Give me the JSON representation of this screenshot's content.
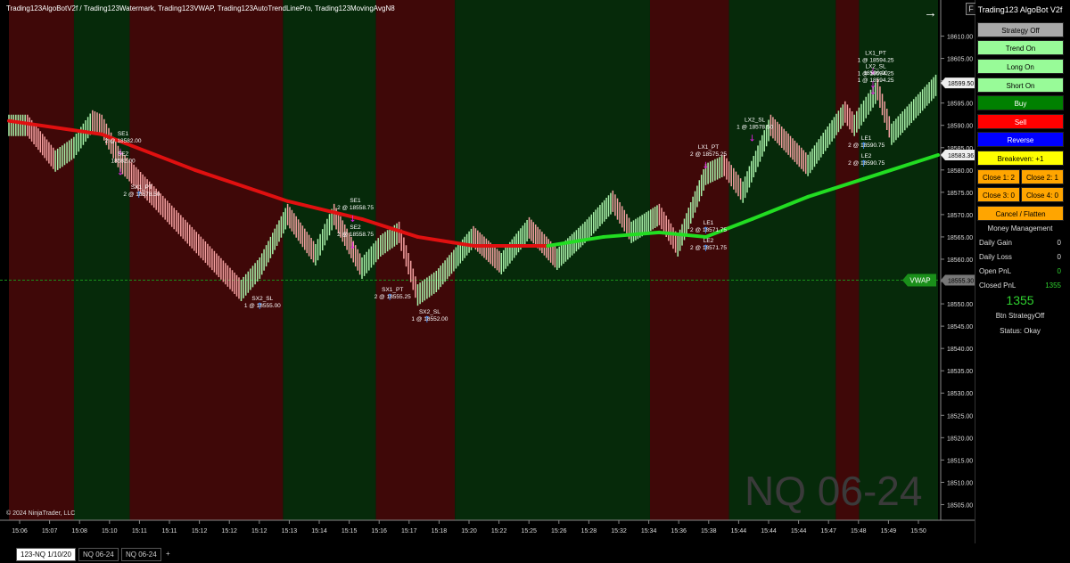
{
  "chart_title": "Trading123AlgoBotV2f / Trading123Watermark, Trading123VWAP, Trading123AutoTrendLinePro, Trading123MovingAvgN8",
  "f_button": "F",
  "copyright": "© 2024 NinjaTrader, LLC",
  "watermark": "NQ 06-24",
  "panel": {
    "title": "Trading123 AlgoBot V2f",
    "strategy_btn": "Strategy Off",
    "trend_btn": "Trend On",
    "long_btn": "Long On",
    "short_btn": "Short On",
    "buy_btn": "Buy",
    "sell_btn": "Sell",
    "reverse_btn": "Reverse",
    "breakeven_btn": "Breakeven: +1",
    "close1_btn": "Close 1: 2",
    "close2_btn": "Close 2: 1",
    "close3_btn": "Close 3: 0",
    "close4_btn": "Close 4: 0",
    "cancel_btn": "Cancel / Flatten",
    "mm_header": "Money Management",
    "daily_gain_label": "Daily Gain",
    "daily_gain": "0",
    "daily_loss_label": "Daily Loss",
    "daily_loss": "0",
    "open_pnl_label": "Open PnL",
    "open_pnl": "0",
    "closed_pnl_label": "Closed PnL",
    "closed_pnl": "1355",
    "big_pnl": "1355",
    "btn_state": "Btn StrategyOff",
    "status": "Status: Okay",
    "colors": {
      "gray": "#a9a9a9",
      "lightgreen": "#98fb98",
      "green": "#008000",
      "red": "#ff0000",
      "blue": "#0000ff",
      "yellow": "#ffff00",
      "orange": "#ffa500"
    }
  },
  "tabs": [
    "123-NQ 1/10/20",
    "NQ 06-24",
    "NQ 06-24",
    "+"
  ],
  "chart_data": {
    "type": "line",
    "ylim": [
      18501.5,
      18614.5
    ],
    "y_ticks": [
      18610.0,
      18605.0,
      18600.0,
      18595.0,
      18590.0,
      18585.0,
      18580.0,
      18575.0,
      18570.0,
      18565.0,
      18560.0,
      18555.0,
      18550.0,
      18545.0,
      18540.0,
      18535.0,
      18530.0,
      18525.0,
      18520.0,
      18515.0,
      18510.0,
      18505.0
    ],
    "x_ticks": [
      "15:06",
      "15:07",
      "15:08",
      "15:10",
      "15:11",
      "15:11",
      "15:12",
      "15:12",
      "15:12",
      "15:13",
      "15:14",
      "15:15",
      "15:16",
      "15:17",
      "15:18",
      "15:20",
      "15:22",
      "15:25",
      "15:26",
      "15:28",
      "15:32",
      "15:34",
      "15:36",
      "15:38",
      "15:44",
      "15:44",
      "15:44",
      "15:47",
      "15:48",
      "15:49",
      "15:50"
    ],
    "price_labels": [
      {
        "text": "18599.50",
        "value": 18599.5,
        "style": "white"
      },
      {
        "text": "18583.36",
        "value": 18583.36,
        "style": "white"
      },
      {
        "text": "18555.30",
        "value": 18555.3,
        "style": "gray"
      }
    ],
    "vwap_label": "VWAP",
    "vwap_value": 18555.3,
    "price_path": [
      [
        0.0,
        18590
      ],
      [
        0.02,
        18590
      ],
      [
        0.05,
        18582
      ],
      [
        0.07,
        18585
      ],
      [
        0.09,
        18591
      ],
      [
        0.1,
        18590
      ],
      [
        0.12,
        18582
      ],
      [
        0.25,
        18553
      ],
      [
        0.27,
        18558
      ],
      [
        0.3,
        18570
      ],
      [
        0.33,
        18561
      ],
      [
        0.35,
        18570
      ],
      [
        0.38,
        18558
      ],
      [
        0.4,
        18563
      ],
      [
        0.42,
        18566
      ],
      [
        0.44,
        18552
      ],
      [
        0.46,
        18555
      ],
      [
        0.5,
        18565
      ],
      [
        0.53,
        18559
      ],
      [
        0.56,
        18567
      ],
      [
        0.59,
        18560
      ],
      [
        0.62,
        18566
      ],
      [
        0.65,
        18573
      ],
      [
        0.67,
        18566
      ],
      [
        0.7,
        18570
      ],
      [
        0.72,
        18563
      ],
      [
        0.75,
        18579
      ],
      [
        0.77,
        18581
      ],
      [
        0.79,
        18575
      ],
      [
        0.82,
        18590
      ],
      [
        0.86,
        18581
      ],
      [
        0.9,
        18593
      ],
      [
        0.91,
        18590
      ],
      [
        0.935,
        18598
      ],
      [
        0.95,
        18588
      ],
      [
        1.0,
        18599.5
      ]
    ],
    "ma_path": [
      [
        0.0,
        18591
      ],
      [
        0.1,
        18588
      ],
      [
        0.2,
        18580
      ],
      [
        0.3,
        18573
      ],
      [
        0.38,
        18569
      ],
      [
        0.44,
        18565
      ],
      [
        0.5,
        18563
      ],
      [
        0.58,
        18563
      ],
      [
        0.64,
        18565
      ],
      [
        0.7,
        18566
      ],
      [
        0.75,
        18565
      ],
      [
        0.8,
        18569
      ],
      [
        0.86,
        18574
      ],
      [
        0.92,
        18578
      ],
      [
        1.0,
        18583.36
      ]
    ],
    "ma_color_switch": 0.55,
    "annotations": [
      {
        "text": [
          "SE1",
          "2 @ 18582.00"
        ],
        "x": 0.12,
        "y": 18585,
        "arrow": "down"
      },
      {
        "text": [
          "SE2",
          "18582.00"
        ],
        "x": 0.12,
        "y": 18580.5,
        "arrow": "down"
      },
      {
        "text": [
          "SX1_PT",
          "2 @ 18578.50"
        ],
        "x": 0.14,
        "y": 18573,
        "arrow": "up"
      },
      {
        "text": [
          "SX2_SL",
          "1 @ 18555.00"
        ],
        "x": 0.27,
        "y": 18548,
        "arrow": "up"
      },
      {
        "text": [
          "SE1",
          "2 @ 18558.75"
        ],
        "x": 0.37,
        "y": 18570,
        "arrow": "down"
      },
      {
        "text": [
          "SE2",
          "2 @ 18558.75"
        ],
        "x": 0.37,
        "y": 18564,
        "arrow": "down"
      },
      {
        "text": [
          "SX1_PT",
          "2 @ 18555.25"
        ],
        "x": 0.41,
        "y": 18550,
        "arrow": "up"
      },
      {
        "text": [
          "SX2_SL",
          "1 @ 18552.00"
        ],
        "x": 0.45,
        "y": 18545,
        "arrow": "up"
      },
      {
        "text": [
          "LX1_PT",
          "2 @ 18575.25"
        ],
        "x": 0.75,
        "y": 18582,
        "arrow": "down"
      },
      {
        "text": [
          "LE1",
          "2 @ 18571.75"
        ],
        "x": 0.75,
        "y": 18565,
        "arrow": "up"
      },
      {
        "text": [
          "LE2",
          "2 @ 18571.75"
        ],
        "x": 0.75,
        "y": 18561,
        "arrow": "up"
      },
      {
        "text": [
          "LX2_SL",
          "1 @ 18578.50"
        ],
        "x": 0.8,
        "y": 18588,
        "arrow": "down"
      },
      {
        "text": [
          "LE1",
          "2 @ 18590.75"
        ],
        "x": 0.92,
        "y": 18584,
        "arrow": "up"
      },
      {
        "text": [
          "LE2",
          "2 @ 18590.75"
        ],
        "x": 0.92,
        "y": 18580,
        "arrow": "up"
      },
      {
        "text": [
          "LX1_PT",
          "1 @ 18594.25"
        ],
        "x": 0.93,
        "y": 18603,
        "arrow": "down"
      },
      {
        "text": [
          "LX2_SL",
          "1 @ 18594.25"
        ],
        "x": 0.93,
        "y": 18600,
        "arrow": "down"
      },
      {
        "text": [
          "18590.00",
          "1 @ 18594.25"
        ],
        "x": 0.93,
        "y": 18598.5,
        "arrow": "down"
      }
    ],
    "background_bands": [
      {
        "from": 0.0,
        "to": 0.07,
        "color": "red"
      },
      {
        "from": 0.07,
        "to": 0.13,
        "color": "green"
      },
      {
        "from": 0.13,
        "to": 0.295,
        "color": "red"
      },
      {
        "from": 0.295,
        "to": 0.395,
        "color": "green"
      },
      {
        "from": 0.395,
        "to": 0.48,
        "color": "red"
      },
      {
        "from": 0.48,
        "to": 0.69,
        "color": "green"
      },
      {
        "from": 0.69,
        "to": 0.775,
        "color": "red"
      },
      {
        "from": 0.775,
        "to": 0.89,
        "color": "green"
      },
      {
        "from": 0.89,
        "to": 0.915,
        "color": "red"
      },
      {
        "from": 0.915,
        "to": 1.0,
        "color": "green"
      }
    ]
  }
}
